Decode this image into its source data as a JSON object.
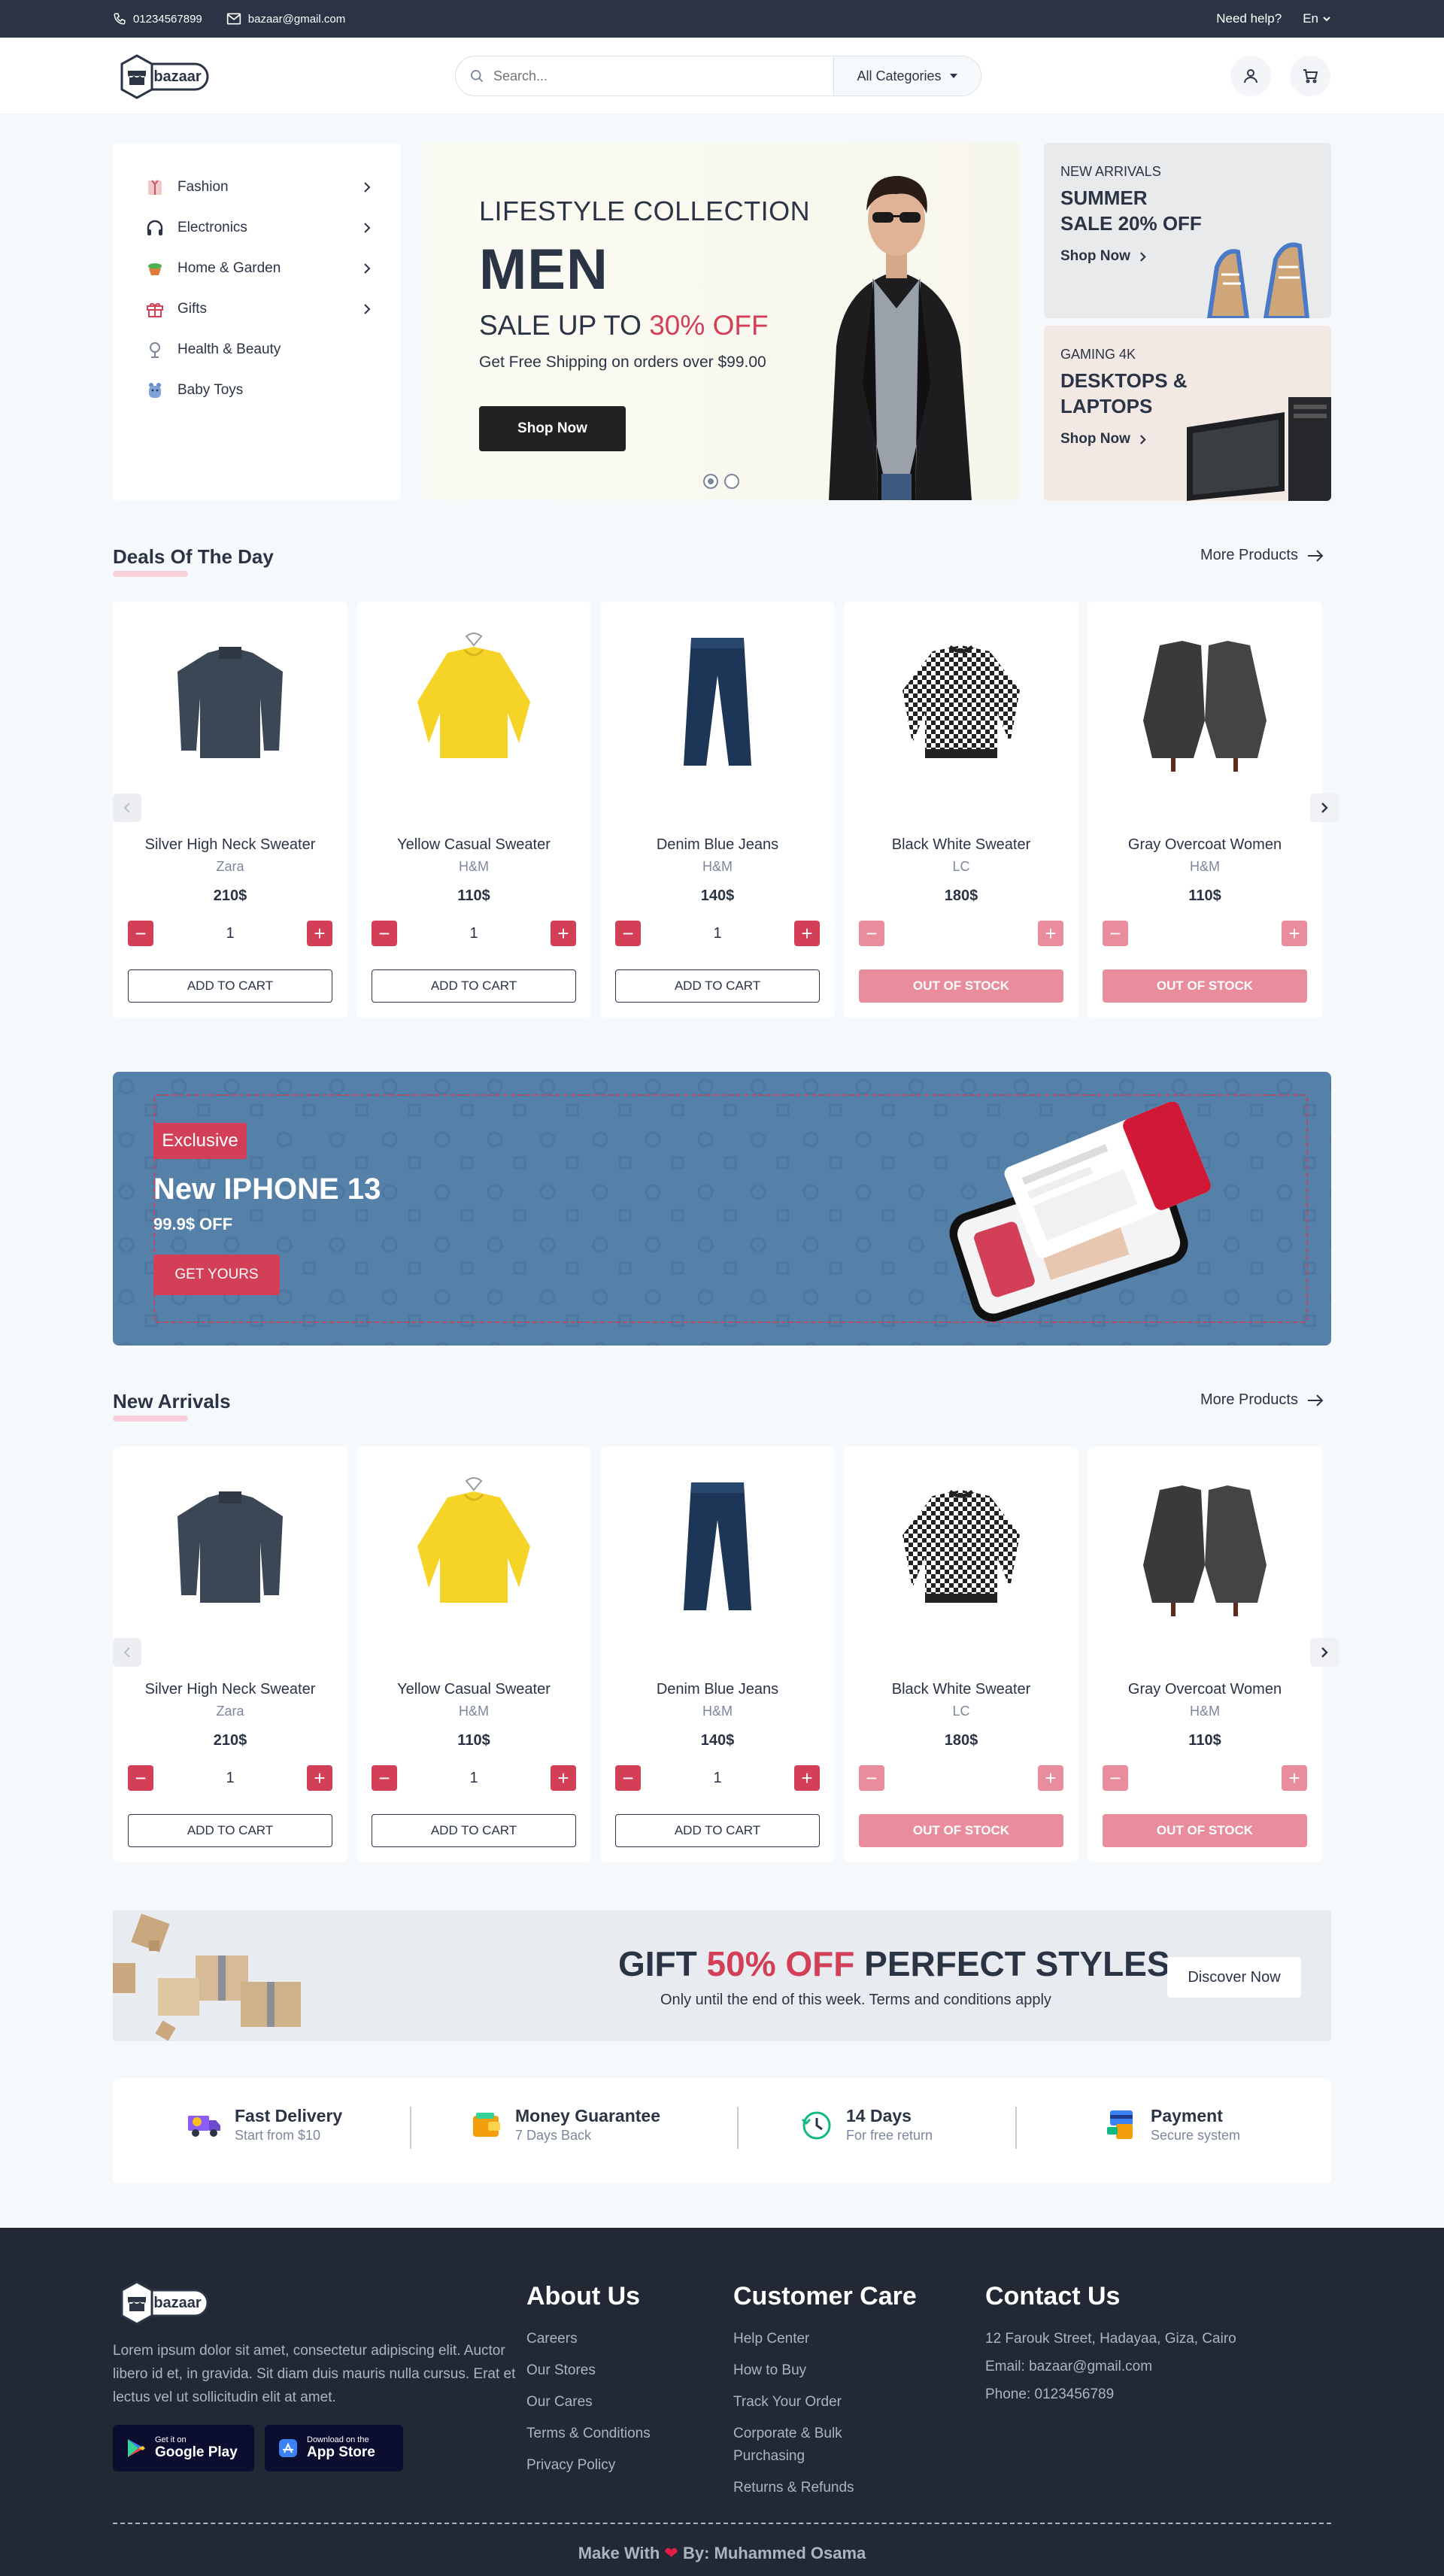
{
  "topbar": {
    "phone": "01234567899",
    "email": "bazaar@gmail.com",
    "help": "Need help?",
    "lang": "En"
  },
  "header": {
    "logo_text": "bazaar",
    "search_placeholder": "Search...",
    "category_select": "All Categories"
  },
  "categories": [
    {
      "label": "Fashion",
      "icon": "dress-icon",
      "has_sub": true
    },
    {
      "label": "Electronics",
      "icon": "headphones-icon",
      "has_sub": true
    },
    {
      "label": "Home & Garden",
      "icon": "plant-pot-icon",
      "has_sub": true
    },
    {
      "label": "Gifts",
      "icon": "gift-icon",
      "has_sub": true
    },
    {
      "label": "Health & Beauty",
      "icon": "beauty-icon",
      "has_sub": false
    },
    {
      "label": "Baby Toys",
      "icon": "toy-icon",
      "has_sub": false
    }
  ],
  "hero": {
    "kicker": "LIFESTYLE COLLECTION",
    "title": "MEN",
    "sale_prefix": "SALE UP TO ",
    "sale_accent": "30% OFF",
    "shipping": "Get Free Shipping on orders over $99.00",
    "button": "Shop Now",
    "slide_count": 2,
    "active_slide": 1
  },
  "promos": [
    {
      "tag": "NEW ARRIVALS",
      "title": "SUMMER SALE 20% OFF",
      "link": "Shop Now"
    },
    {
      "tag": "GAMING 4K",
      "title": "DESKTOPS & LAPTOPS",
      "link": "Shop Now"
    }
  ],
  "deals": {
    "title": "Deals Of The Day",
    "more": "More Products",
    "products": [
      {
        "name": "Silver High Neck Sweater",
        "brand": "Zara",
        "price": "210$",
        "qty": "1",
        "action": "ADD TO CART",
        "in_stock": true
      },
      {
        "name": "Yellow Casual Sweater",
        "brand": "H&M",
        "price": "110$",
        "qty": "1",
        "action": "ADD TO CART",
        "in_stock": true
      },
      {
        "name": "Denim Blue Jeans",
        "brand": "H&M",
        "price": "140$",
        "qty": "1",
        "action": "ADD TO CART",
        "in_stock": true
      },
      {
        "name": "Black White Sweater",
        "brand": "LC",
        "price": "180$",
        "qty": "",
        "action": "OUT OF STOCK",
        "in_stock": false
      },
      {
        "name": "Gray Overcoat Women",
        "brand": "H&M",
        "price": "110$",
        "qty": "",
        "action": "OUT OF STOCK",
        "in_stock": false
      }
    ]
  },
  "phone_banner": {
    "badge": "Exclusive",
    "title": "New IPHONE 13",
    "price": "99.9$ OFF",
    "button": "GET YOURS"
  },
  "arrivals": {
    "title": "New Arrivals",
    "more": "More Products",
    "products": [
      {
        "name": "Silver High Neck Sweater",
        "brand": "Zara",
        "price": "210$",
        "qty": "1",
        "action": "ADD TO CART",
        "in_stock": true
      },
      {
        "name": "Yellow Casual Sweater",
        "brand": "H&M",
        "price": "110$",
        "qty": "1",
        "action": "ADD TO CART",
        "in_stock": true
      },
      {
        "name": "Denim Blue Jeans",
        "brand": "H&M",
        "price": "140$",
        "qty": "1",
        "action": "ADD TO CART",
        "in_stock": true
      },
      {
        "name": "Black White Sweater",
        "brand": "LC",
        "price": "180$",
        "qty": "",
        "action": "OUT OF STOCK",
        "in_stock": false
      },
      {
        "name": "Gray Overcoat Women",
        "brand": "H&M",
        "price": "110$",
        "qty": "",
        "action": "OUT OF STOCK",
        "in_stock": false
      }
    ]
  },
  "gift_banner": {
    "title_prefix": "GIFT ",
    "title_accent": "50% OFF",
    "title_suffix": " PERFECT STYLES",
    "subtitle": "Only until the end of this week. Terms and conditions apply",
    "button": "Discover Now"
  },
  "services": [
    {
      "title": "Fast Delivery",
      "sub": "Start from $10",
      "icon": "delivery-truck-icon"
    },
    {
      "title": "Money Guarantee",
      "sub": "7 Days Back",
      "icon": "wallet-icon"
    },
    {
      "title": "14 Days",
      "sub": "For free return",
      "icon": "clock-return-icon"
    },
    {
      "title": "Payment",
      "sub": "Secure system",
      "icon": "secure-payment-icon"
    }
  ],
  "footer": {
    "logo_text": "bazaar",
    "description": "Lorem ipsum dolor sit amet, consectetur adipiscing elit. Auctor libero id et, in gravida. Sit diam duis mauris nulla cursus. Erat et lectus vel ut sollicitudin elit at amet.",
    "google_play": {
      "small": "Get it on",
      "big": "Google Play"
    },
    "app_store": {
      "small": "Download on the",
      "big": "App Store"
    },
    "about": {
      "title": "About Us",
      "links": [
        "Careers",
        "Our Stores",
        "Our Cares",
        "Terms & Conditions",
        "Privacy Policy"
      ]
    },
    "care": {
      "title": "Customer Care",
      "links": [
        "Help Center",
        "How to Buy",
        "Track Your Order",
        "Corporate & Bulk Purchasing",
        "Returns & Refunds"
      ]
    },
    "contact": {
      "title": "Contact Us",
      "lines": [
        "12 Farouk Street, Hadayaa, Giza, Cairo",
        "Email: bazaar@gmail.com",
        "Phone: 0123456789"
      ]
    },
    "made_prefix": "Make With",
    "made_suffix": "By:  Muhammed Osama"
  },
  "colors": {
    "accent": "#d23f57",
    "dark": "#2b3445",
    "muted": "#7d879c",
    "footer_bg": "#222935",
    "banner_blue": "#5580a8"
  }
}
